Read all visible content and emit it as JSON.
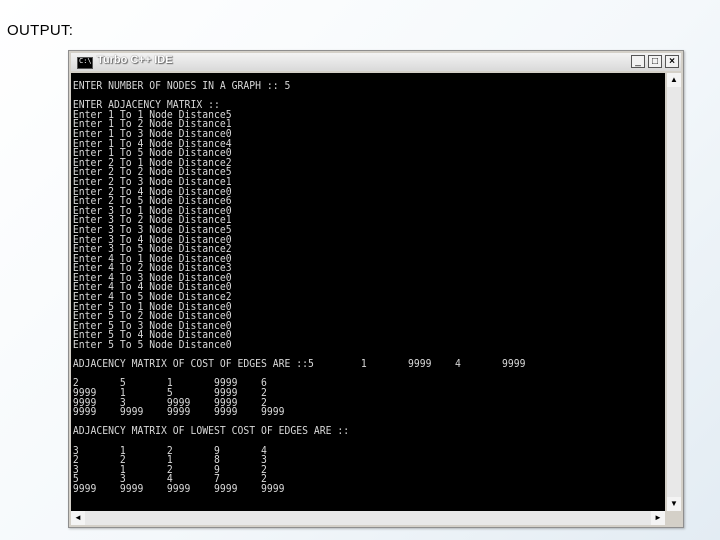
{
  "slide": {
    "label": "OUTPUT:"
  },
  "window": {
    "title": "Turbo C++ IDE",
    "icon_text": "C:\\",
    "buttons": {
      "minimize": "_",
      "maximize": "□",
      "close": "×"
    }
  },
  "console": {
    "lines": [
      "ENTER NUMBER OF NODES IN A GRAPH :: 5",
      "ENTER ADJACENCY MATRIX ::",
      "Enter 1 To 1 Node Distance5",
      "Enter 1 To 2 Node Distance1",
      "Enter 1 To 3 Node Distance0",
      "Enter 1 To 4 Node Distance4",
      "Enter 1 To 5 Node Distance0",
      "Enter 2 To 1 Node Distance2",
      "Enter 2 To 2 Node Distance5",
      "Enter 2 To 3 Node Distance1",
      "Enter 2 To 4 Node Distance0",
      "Enter 2 To 5 Node Distance6",
      "Enter 3 To 1 Node Distance0",
      "Enter 3 To 2 Node Distance1",
      "Enter 3 To 3 Node Distance5",
      "Enter 3 To 4 Node Distance0",
      "Enter 3 To 5 Node Distance2",
      "Enter 4 To 1 Node Distance0",
      "Enter 4 To 2 Node Distance3",
      "Enter 4 To 3 Node Distance0",
      "Enter 4 To 4 Node Distance0",
      "Enter 4 To 5 Node Distance2",
      "Enter 5 To 1 Node Distance0",
      "Enter 5 To 2 Node Distance0",
      "Enter 5 To 3 Node Distance0",
      "Enter 5 To 4 Node Distance0",
      "Enter 5 To 5 Node Distance0",
      "ADJACENCY MATRIX OF COST OF EDGES ARE ::5        1       9999    4       9999",
      "2       5       1       9999    6",
      "9999    1       5       9999    2",
      "9999    3       9999    9999    2",
      "9999    9999    9999    9999    9999",
      "ADJACENCY MATRIX OF LOWEST COST OF EDGES ARE ::",
      "3       1       2       9       4",
      "2       2       1       8       3",
      "3       1       2       9       2",
      "5       3       4       7       2",
      "9999    9999    9999    9999    9999"
    ]
  },
  "scrollbars": {
    "up": "▲",
    "down": "▼",
    "left": "◄",
    "right": "►"
  }
}
